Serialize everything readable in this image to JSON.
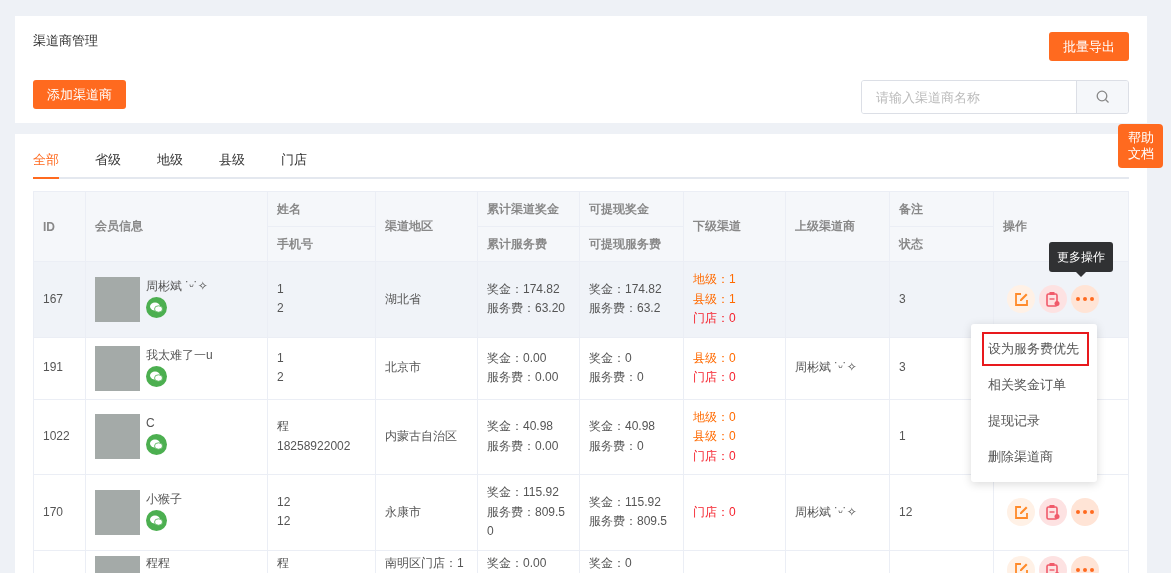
{
  "header": {
    "title": "渠道商管理",
    "export_button": "批量导出",
    "add_button": "添加渠道商",
    "search": {
      "placeholder": "请输入渠道商名称"
    }
  },
  "help_button": "帮助文档",
  "tabs": [
    {
      "label": "全部",
      "selected": true
    },
    {
      "label": "省级",
      "selected": false
    },
    {
      "label": "地级",
      "selected": false
    },
    {
      "label": "县级",
      "selected": false
    },
    {
      "label": "门店",
      "selected": false
    }
  ],
  "table": {
    "columns": [
      {
        "top": "ID"
      },
      {
        "top": "会员信息"
      },
      {
        "top": "姓名",
        "bottom": "手机号"
      },
      {
        "top": "渠道地区"
      },
      {
        "top": "累计渠道奖金",
        "bottom": "累计服务费"
      },
      {
        "top": "可提现奖金",
        "bottom": "可提现服务费"
      },
      {
        "top": "下级渠道"
      },
      {
        "top": "上级渠道商"
      },
      {
        "top": "备注",
        "bottom": "状态"
      },
      {
        "top": "操作"
      }
    ],
    "rows": [
      {
        "id": "167",
        "hovered": true,
        "member": "周彬斌 ˙ᵕ˙✧",
        "wechat": true,
        "contact": [
          "1",
          "2"
        ],
        "region": "湖北省",
        "total": [
          "奖金：174.82",
          "服务费：63.20"
        ],
        "withdrawable": [
          "奖金：174.82",
          "服务费：63.2"
        ],
        "sub_channels": [
          {
            "text": "地级：1",
            "kind": "region"
          },
          {
            "text": "县级：1",
            "kind": "region"
          },
          {
            "text": "门店：0",
            "kind": "store"
          }
        ],
        "status": "3",
        "actions_shown": true
      },
      {
        "id": "191",
        "hovered": false,
        "member": "我太难了一u",
        "wechat": true,
        "contact": [
          "1",
          "2"
        ],
        "region": "北京市",
        "total": [
          "奖金：0.00",
          "服务费：0.00"
        ],
        "withdrawable": [
          "奖金：0",
          "服务费：0"
        ],
        "sub_channels": [
          {
            "text": "县级：0",
            "kind": "region"
          },
          {
            "text": "门店：0",
            "kind": "store"
          }
        ],
        "parent": "周彬斌 ˙ᵕ˙✧",
        "status": "3",
        "actions_shown": false
      },
      {
        "id": "1022",
        "hovered": false,
        "member": "C",
        "wechat": true,
        "contact": [
          "程",
          "18258922002"
        ],
        "region": "内蒙古自治区",
        "total": [
          "奖金：40.98",
          "服务费：0.00"
        ],
        "withdrawable": [
          "奖金：40.98",
          "服务费：0"
        ],
        "sub_channels": [
          {
            "text": "地级：0",
            "kind": "region"
          },
          {
            "text": "县级：0",
            "kind": "region"
          },
          {
            "text": "门店：0",
            "kind": "store"
          }
        ],
        "status": "1",
        "actions_shown": false
      },
      {
        "id": "170",
        "hovered": false,
        "member": "小猴子",
        "wechat": true,
        "contact": [
          "12",
          "12"
        ],
        "region": "永康市",
        "total": [
          "奖金：115.92",
          "服务费：809.50"
        ],
        "withdrawable": [
          "奖金：115.92",
          "服务费：809.5"
        ],
        "sub_channels": [
          {
            "text": "门店：0",
            "kind": "store"
          }
        ],
        "parent": "周彬斌 ˙ᵕ˙✧",
        "status": "12",
        "actions_shown": true
      },
      {
        "hovered": false,
        "member": "程程",
        "contact": [
          "程"
        ],
        "region": "南明区门店：1",
        "total": [
          "奖金：0.00"
        ],
        "withdrawable": [
          "奖金：0"
        ],
        "actions_shown": true
      }
    ]
  },
  "tooltip": "更多操作",
  "more_menu": [
    {
      "label": "设为服务费优先",
      "outlined": true
    },
    {
      "label": "相关奖金订单",
      "outlined": false
    },
    {
      "label": "提现记录",
      "outlined": false
    },
    {
      "label": "删除渠道商",
      "outlined": false
    }
  ]
}
